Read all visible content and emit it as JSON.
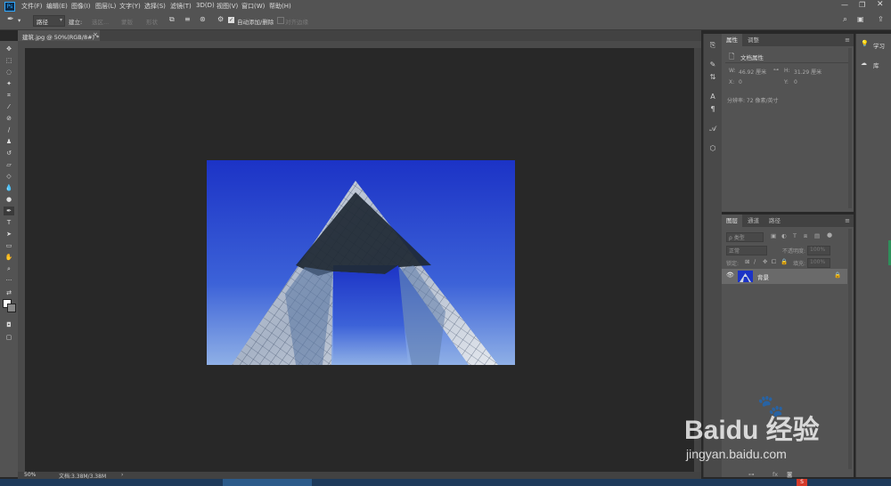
{
  "app": {
    "logo": "Ps"
  },
  "menubar": {
    "items": [
      "文件(F)",
      "编辑(E)",
      "图像(I)",
      "图层(L)",
      "文字(Y)",
      "选择(S)",
      "滤镜(T)",
      "3D(D)",
      "视图(V)",
      "窗口(W)",
      "帮助(H)"
    ]
  },
  "options": {
    "path_mode": "路径",
    "build_label": "建立:",
    "selection_btn": "选区...",
    "mask_btn": "蒙版",
    "shape_btn": "形状",
    "auto_add_delete": "自动添加/删除",
    "align_edges": "对齐边缘"
  },
  "document": {
    "tab_title": "建筑.jpg @ 50%(RGB/8#) *",
    "zoom": "50%",
    "doc_size": "文档:3.38M/3.38M"
  },
  "properties": {
    "tabs": [
      "属性",
      "调整"
    ],
    "section": "文档属性",
    "w_label": "W:",
    "w_value": "46.92 厘米",
    "h_label": "H:",
    "h_value": "31.29 厘米",
    "x_label": "X:",
    "x_value": "0",
    "y_label": "Y:",
    "y_value": "0",
    "resolution": "分辨率: 72 像素/英寸"
  },
  "layers": {
    "tabs": [
      "图层",
      "通道",
      "路径"
    ],
    "filter_kind": "ρ 类型",
    "blend_mode": "正常",
    "opacity_label": "不透明度:",
    "opacity_value": "100%",
    "lock_label": "锁定:",
    "fill_label": "填充:",
    "fill_value": "100%",
    "layer_name": "背景"
  },
  "right_panel": {
    "learn": "学习",
    "library": "库"
  },
  "watermark": {
    "brand": "Baidu 经验",
    "url": "jingyan.baidu.com"
  },
  "colors": {
    "sky_top": "#1c33c6",
    "sky_bottom": "#8fb0e6",
    "ui_panel": "#535353",
    "ui_dark": "#282828"
  }
}
